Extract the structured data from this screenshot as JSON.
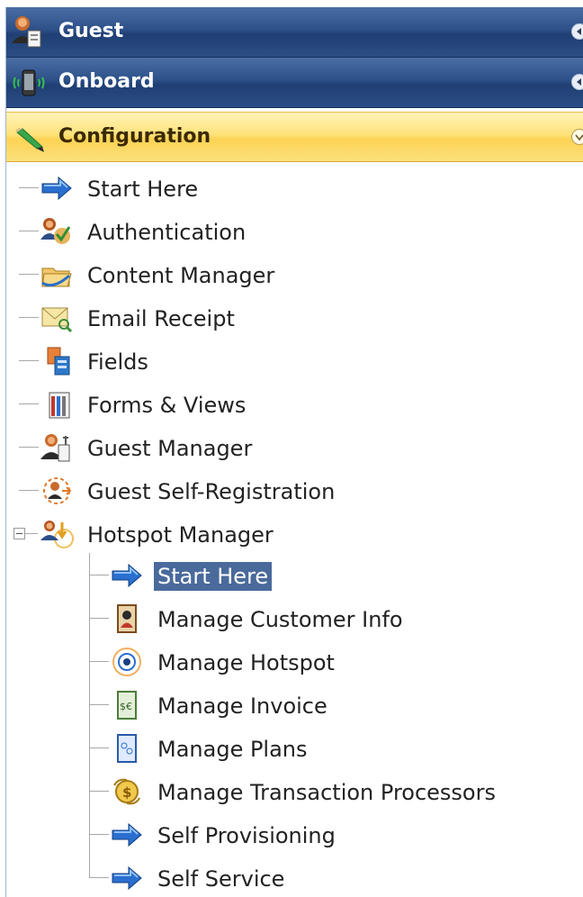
{
  "headers": {
    "guest": {
      "label": "Guest",
      "icon": "guest-user-icon"
    },
    "onboard": {
      "label": "Onboard",
      "icon": "mobile-device-icon"
    },
    "configuration": {
      "label": "Configuration",
      "icon": "pencil-icon"
    }
  },
  "tree": {
    "items": [
      {
        "label": "Start Here",
        "icon": "arrow-right-icon"
      },
      {
        "label": "Authentication",
        "icon": "authentication-icon"
      },
      {
        "label": "Content Manager",
        "icon": "content-manager-icon"
      },
      {
        "label": "Email Receipt",
        "icon": "email-icon"
      },
      {
        "label": "Fields",
        "icon": "fields-icon"
      },
      {
        "label": "Forms & Views",
        "icon": "forms-icon"
      },
      {
        "label": "Guest Manager",
        "icon": "guest-manager-icon"
      },
      {
        "label": "Guest Self-Registration",
        "icon": "self-registration-icon"
      },
      {
        "label": "Hotspot Manager",
        "icon": "hotspot-manager-icon"
      }
    ],
    "hotspot_children": [
      {
        "label": "Start Here",
        "icon": "arrow-right-icon",
        "selected": true
      },
      {
        "label": "Manage Customer Info",
        "icon": "customer-info-icon"
      },
      {
        "label": "Manage Hotspot",
        "icon": "hotspot-icon"
      },
      {
        "label": "Manage Invoice",
        "icon": "invoice-icon"
      },
      {
        "label": "Manage Plans",
        "icon": "plans-icon"
      },
      {
        "label": "Manage Transaction Processors",
        "icon": "transaction-icon"
      },
      {
        "label": "Self Provisioning",
        "icon": "arrow-right-icon"
      },
      {
        "label": "Self Service",
        "icon": "arrow-right-icon"
      }
    ]
  },
  "colors": {
    "header_blue": "#2d5089",
    "header_yellow": "#fdd353",
    "selection": "#4a6a9c"
  }
}
